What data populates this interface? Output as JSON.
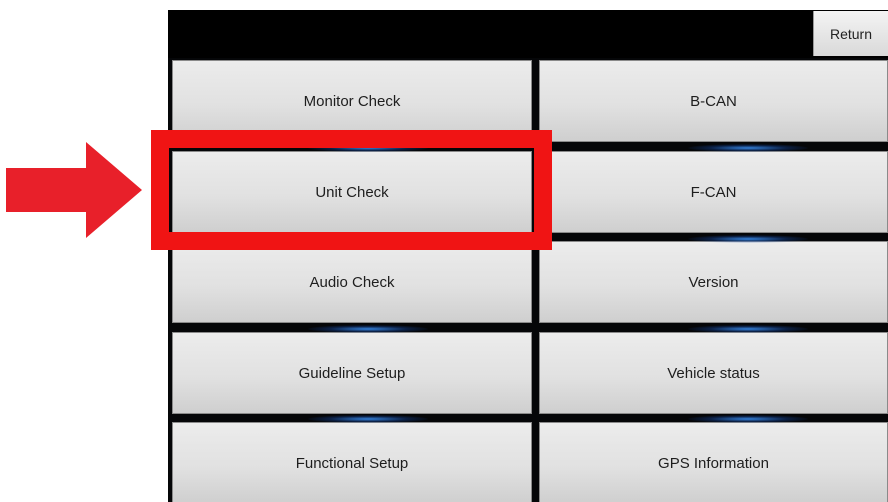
{
  "header": {
    "return_label": "Return"
  },
  "menu": {
    "left": [
      {
        "label": "Monitor Check"
      },
      {
        "label": "Unit Check"
      },
      {
        "label": "Audio Check"
      },
      {
        "label": "Guideline Setup"
      },
      {
        "label": "Functional Setup"
      }
    ],
    "right": [
      {
        "label": "B-CAN"
      },
      {
        "label": "F-CAN"
      },
      {
        "label": "Version"
      },
      {
        "label": "Vehicle status"
      },
      {
        "label": "GPS Information"
      }
    ]
  },
  "annotation": {
    "highlight_color": "#f01414",
    "arrow_color": "#e8202a",
    "arrow_icon": "arrow-right-icon"
  }
}
